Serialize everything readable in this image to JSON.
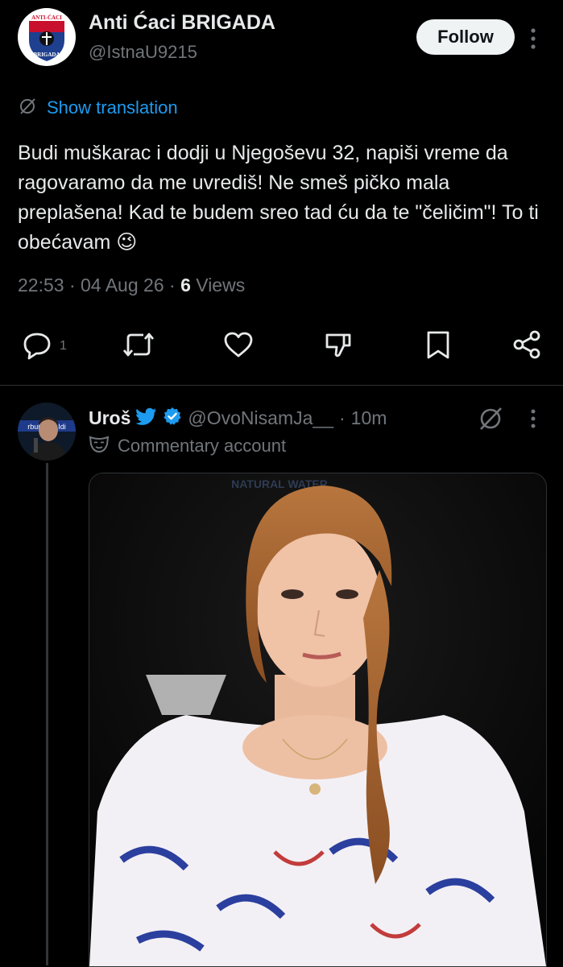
{
  "tweet": {
    "author_name": "Anti Ćaci BRIGADA",
    "author_handle": "@IstnaU9215",
    "avatar_text_top": "ANTI-ĆACI",
    "avatar_text_bottom": "BRIGADA",
    "follow_label": "Follow",
    "translate_label": "Show translation",
    "text": "Budi muškarac i dodji u Njegoševu 32, napiši vreme da ragovaramo da me uvrediš! Ne smeš pičko mala preplašena! Kad te budem sreo tad ću da te \"čeličim\"! To ti obećavam 😉",
    "time": "22:53",
    "date": "04 Aug 26",
    "views_count": "6",
    "views_label": "Views",
    "reply_count": "1"
  },
  "reply": {
    "author_name": "Uroš",
    "handle": "@OvoNisamJa__",
    "time": "10m",
    "label": "Commentary account",
    "avatar_text": "rbul   grad Idi",
    "media_text": "NATURAL   WATER"
  },
  "colors": {
    "background": "#000000",
    "text_primary": "#e7e9ea",
    "text_secondary": "#71767b",
    "link": "#1d9bf0",
    "verified": "#1d9bf0",
    "divider": "#2f3336"
  },
  "icons": [
    "grok-icon",
    "reply-icon",
    "retweet-icon",
    "like-icon",
    "dislike-icon",
    "bookmark-icon",
    "share-icon",
    "more-icon",
    "bird-icon",
    "verified-icon",
    "mask-icon"
  ]
}
